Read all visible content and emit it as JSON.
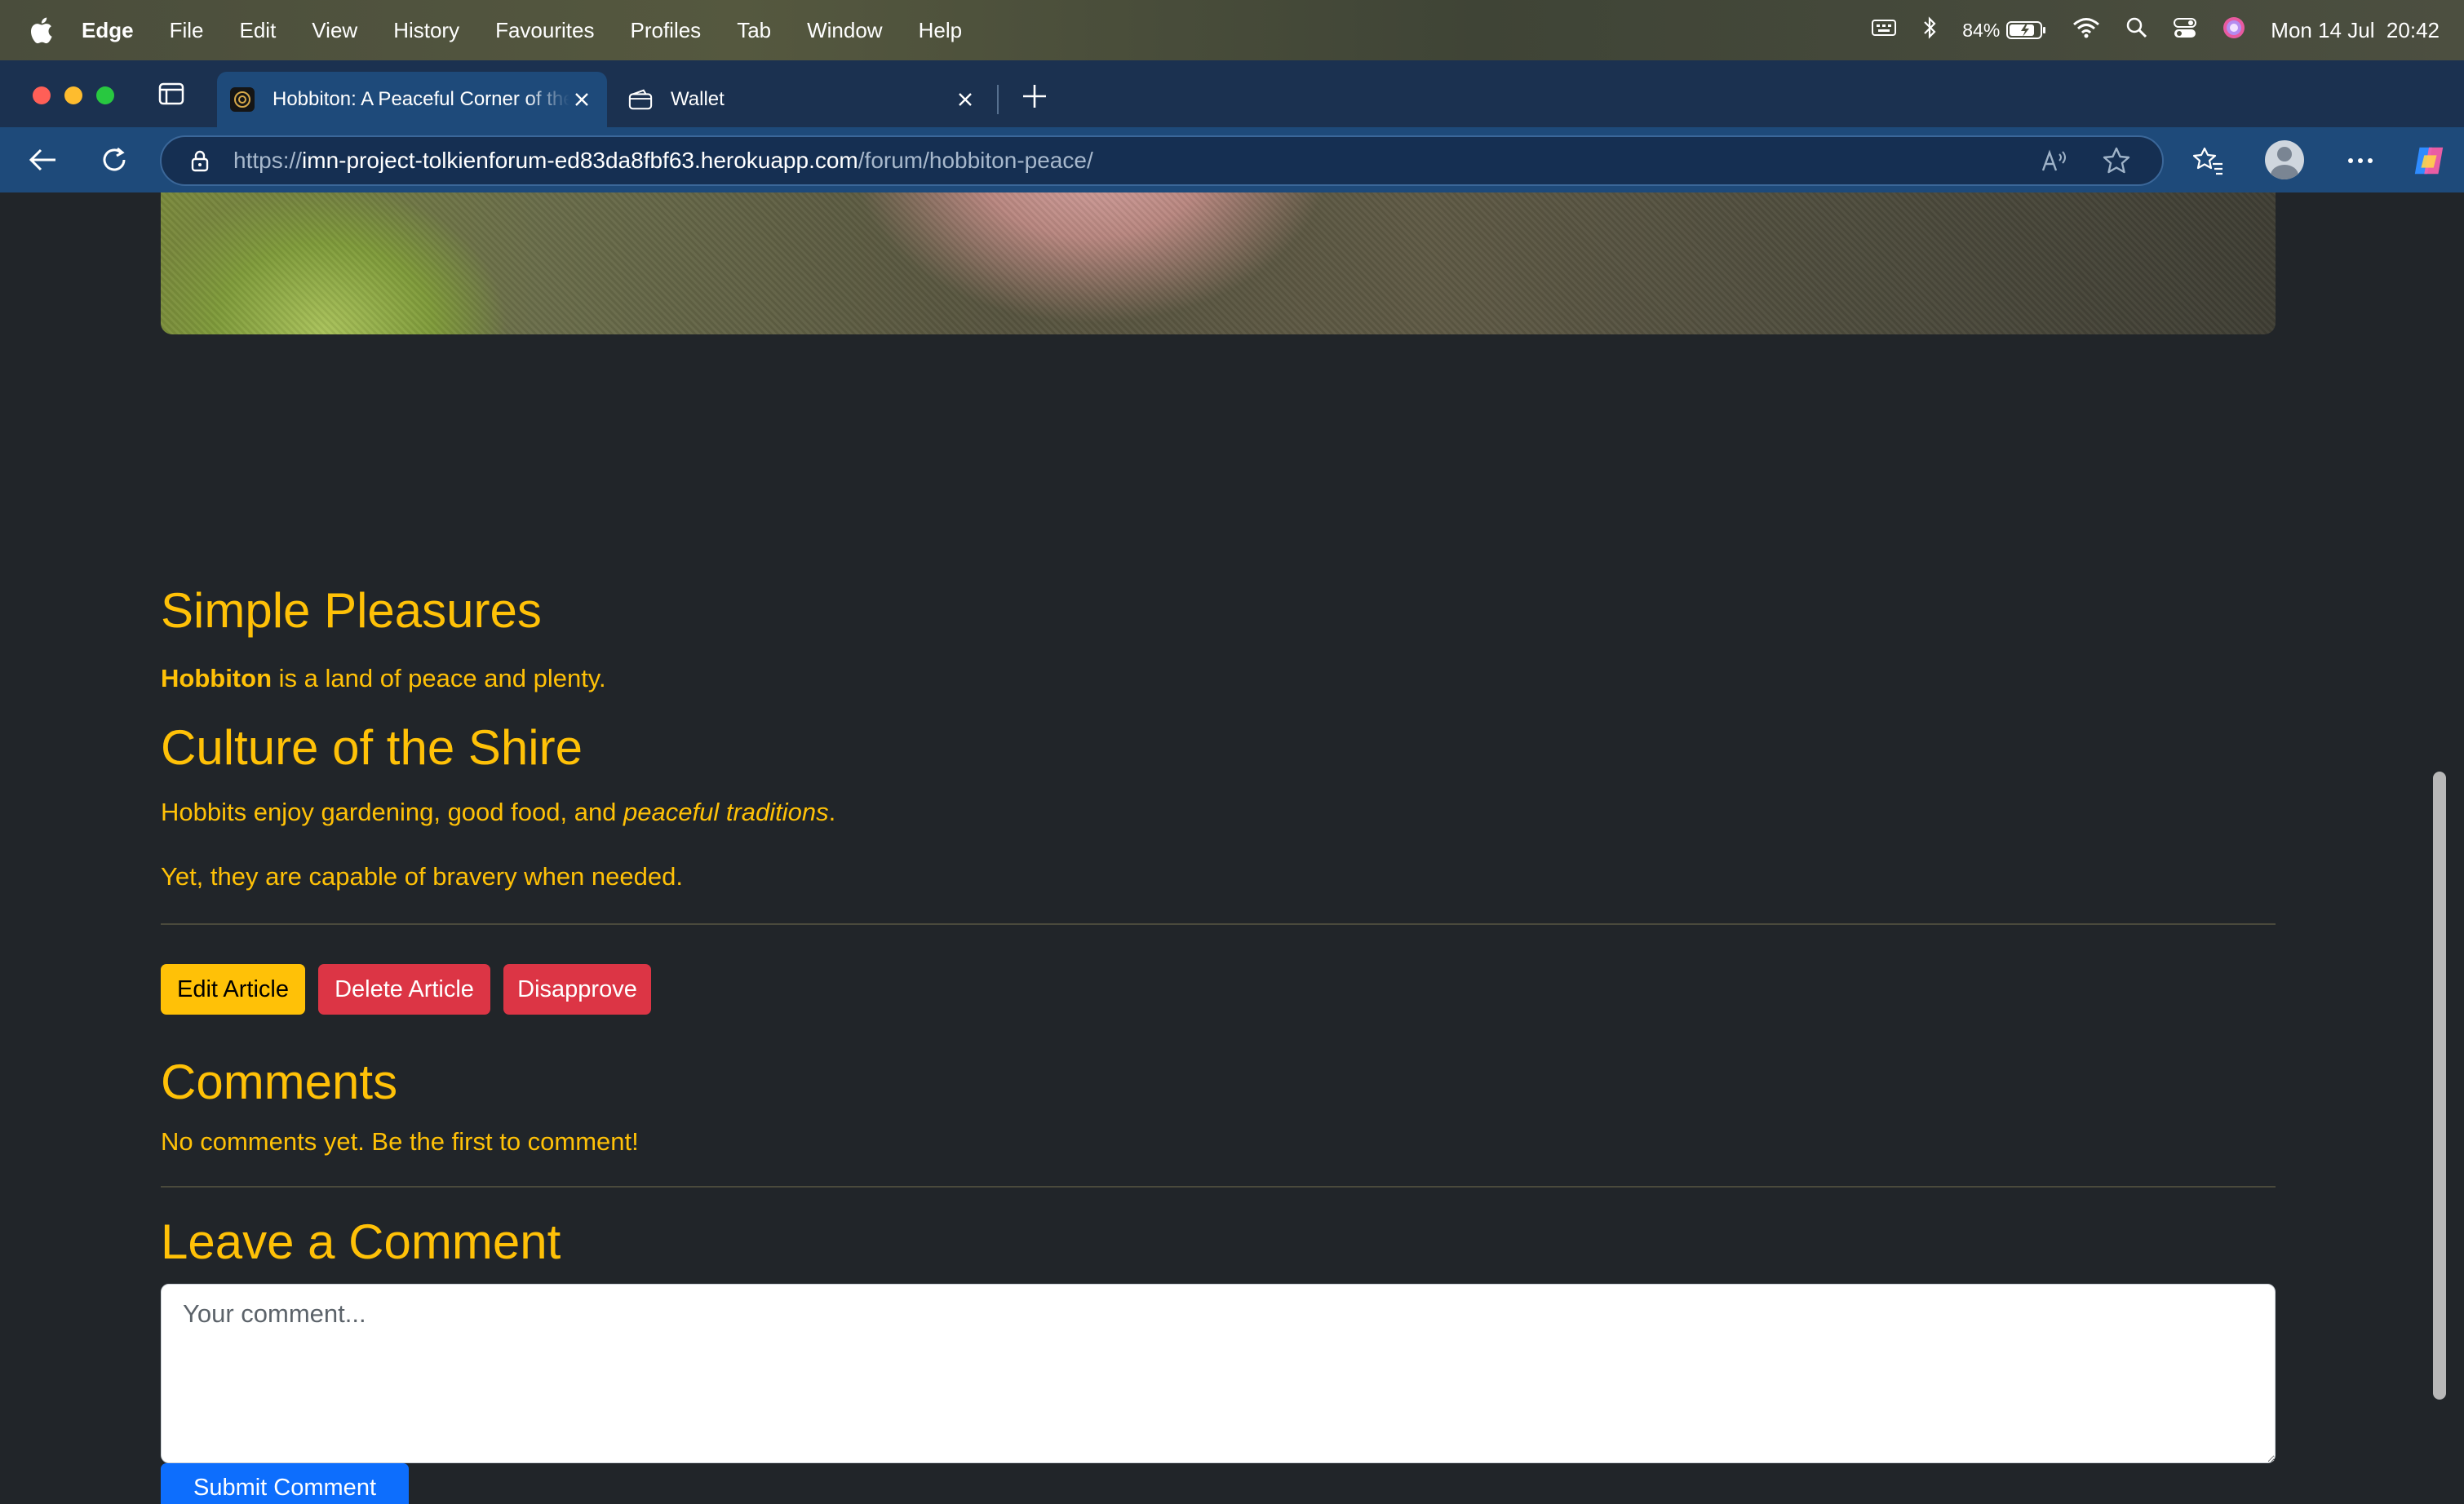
{
  "menubar": {
    "app_name": "Edge",
    "items": [
      "File",
      "Edit",
      "View",
      "History",
      "Favourites",
      "Profiles",
      "Tab",
      "Window",
      "Help"
    ],
    "battery": "84%",
    "datetime": "Mon 14 Jul  20:42"
  },
  "tabs": [
    {
      "title": "Hobbiton: A Peaceful Corner of the Shire",
      "active": true
    },
    {
      "title": "Wallet",
      "active": false
    }
  ],
  "address_bar": {
    "scheme": "https://",
    "host": "imn-project-tolkienforum-ed83da8fbf63.herokuapp.com",
    "path": "/forum/hobbiton-peace/"
  },
  "article": {
    "section1_heading": "Simple Pleasures",
    "section1_bold": "Hobbiton",
    "section1_text": " is a land of peace and plenty.",
    "section2_heading": "Culture of the Shire",
    "section2_text_a": "Hobbits enjoy gardening, good food, and ",
    "section2_italic": "peaceful traditions",
    "section2_text_b": ".",
    "section2_para2": "Yet, they are capable of bravery when needed."
  },
  "actions": {
    "edit": "Edit Article",
    "delete": "Delete Article",
    "disapprove": "Disapprove"
  },
  "comments": {
    "heading": "Comments",
    "empty_text": "No comments yet. Be the first to comment!",
    "form_heading": "Leave a Comment",
    "placeholder": "Your comment...",
    "submit": "Submit Comment"
  },
  "colors": {
    "accent": "#ffc107",
    "danger": "#dc3545",
    "primary": "#0d6efd",
    "page_bg": "#212529"
  }
}
